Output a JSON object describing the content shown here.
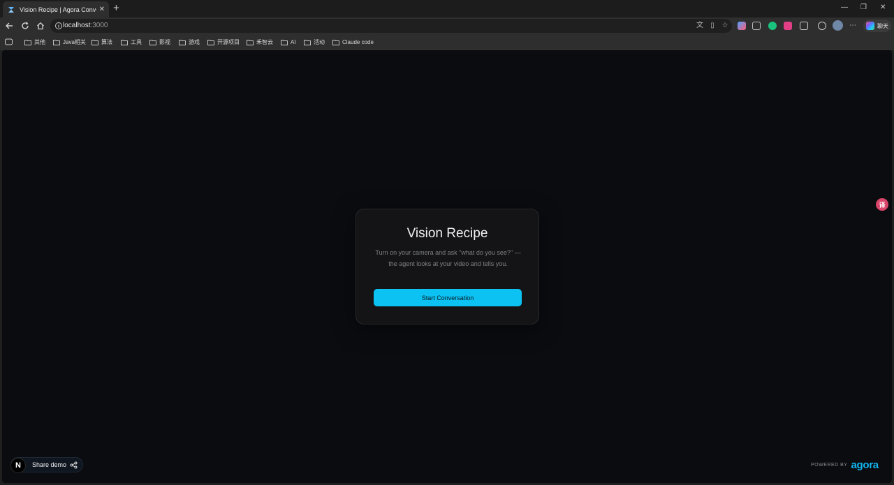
{
  "browser": {
    "tab_title": "Vision Recipe | Agora Conversation",
    "url_host": "localhost",
    "url_port": ":3000",
    "chat_label": "聊天"
  },
  "bookmarks": [
    {
      "label": "其他"
    },
    {
      "label": "Java相关"
    },
    {
      "label": "算法"
    },
    {
      "label": "工具"
    },
    {
      "label": "影视"
    },
    {
      "label": "游戏"
    },
    {
      "label": "开源项目"
    },
    {
      "label": "禾智云"
    },
    {
      "label": "AI"
    },
    {
      "label": "活动"
    },
    {
      "label": "Claude code"
    }
  ],
  "card": {
    "title": "Vision Recipe",
    "description_line1": "Turn on your camera and ask \"what do you see?\" —",
    "description_line2": "the agent looks at your video and tells you.",
    "button_label": "Start Conversation"
  },
  "footer": {
    "share_label": "Share demo",
    "next_badge": "N",
    "powered_by": "POWERED BY",
    "brand": "agora"
  },
  "colors": {
    "accent": "#0bc2f2",
    "brand": "#11b6ee",
    "page_bg": "#0b0c10",
    "card_bg": "#141416"
  }
}
